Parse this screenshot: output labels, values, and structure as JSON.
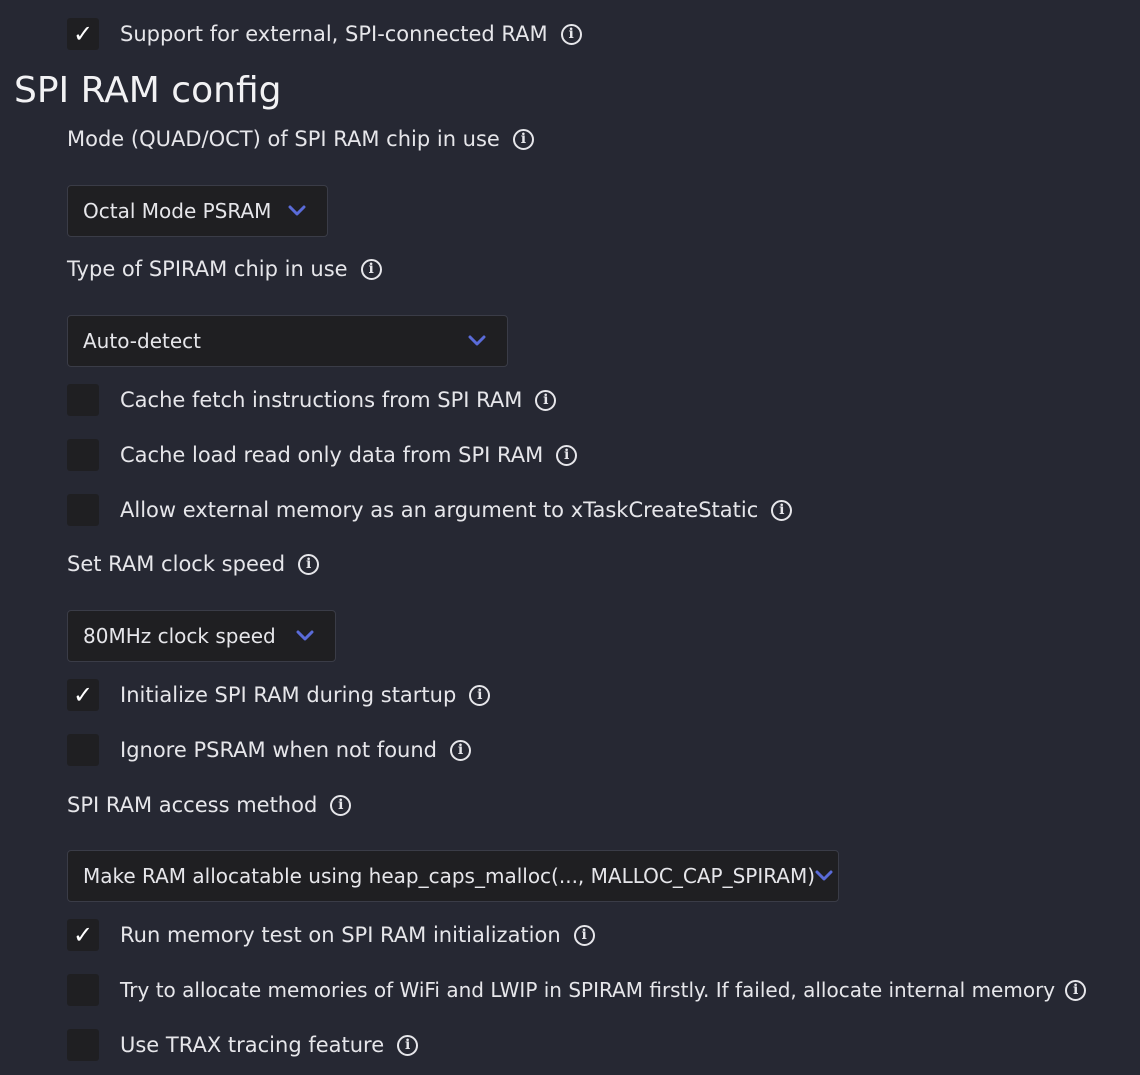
{
  "top_option": {
    "label": "Support for external, SPI-connected RAM",
    "checked": true
  },
  "section_title": "SPI RAM config",
  "mode": {
    "label": "Mode (QUAD/OCT) of SPI RAM chip in use",
    "selected": "Octal Mode PSRAM"
  },
  "chip_type": {
    "label": "Type of SPIRAM chip in use",
    "selected": "Auto-detect"
  },
  "cache_fetch": {
    "label": "Cache fetch instructions from SPI RAM",
    "checked": false
  },
  "cache_rodata": {
    "label": "Cache load read only data from SPI RAM",
    "checked": false
  },
  "allow_external": {
    "label": "Allow external memory as an argument to xTaskCreateStatic",
    "checked": false
  },
  "clock_speed": {
    "label": "Set RAM clock speed",
    "selected": "80MHz clock speed"
  },
  "init_startup": {
    "label": "Initialize SPI RAM during startup",
    "checked": true
  },
  "ignore_psram": {
    "label": "Ignore PSRAM when not found",
    "checked": false
  },
  "access_method": {
    "label": "SPI RAM access method",
    "selected": "Make RAM allocatable using heap_caps_malloc(..., MALLOC_CAP_SPIRAM)"
  },
  "memtest": {
    "label": "Run memory test on SPI RAM initialization",
    "checked": true
  },
  "wifi_lwip": {
    "label": "Try to allocate memories of WiFi and LWIP in SPIRAM firstly. If failed, allocate internal memory",
    "checked": false
  },
  "trax": {
    "label": "Use TRAX tracing feature",
    "checked": false
  },
  "glyphs": {
    "check": "✓",
    "info": "i"
  },
  "colors": {
    "background": "#262833",
    "chevron": "#5a6bd8",
    "control": "#1f1f22"
  }
}
